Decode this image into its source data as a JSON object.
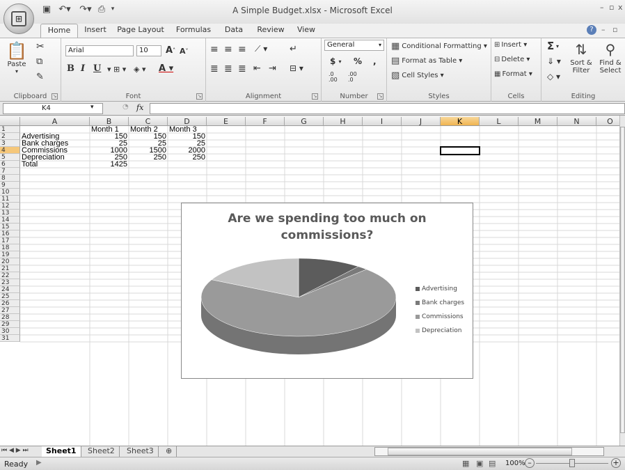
{
  "window": {
    "title": "A Simple Budget.xlsx - Microsoft Excel"
  },
  "quick_access": [
    "save-icon",
    "undo-icon",
    "redo-icon",
    "customize-icon"
  ],
  "tabs": [
    "Home",
    "Insert",
    "Page Layout",
    "Formulas",
    "Data",
    "Review",
    "View"
  ],
  "ribbon": {
    "clipboard": {
      "label": "Clipboard",
      "paste": "Paste"
    },
    "font": {
      "label": "Font",
      "font_name": "Arial",
      "font_size": "10",
      "bold": "B",
      "italic": "I",
      "underline": "U",
      "grow": "A",
      "shrink": "A"
    },
    "alignment": {
      "label": "Alignment"
    },
    "number": {
      "label": "Number",
      "format": "General",
      "currency": "$",
      "percent": "%",
      "comma": ",",
      "inc_dec": ".0 .00",
      "dec_dec": ".00 .0"
    },
    "styles": {
      "label": "Styles",
      "conditional": "Conditional Formatting",
      "format_table": "Format as Table",
      "cell_styles": "Cell Styles"
    },
    "cells": {
      "label": "Cells",
      "insert": "Insert",
      "delete": "Delete",
      "format": "Format"
    },
    "editing": {
      "label": "Editing",
      "sigma": "Σ",
      "sort_filter": "Sort & Filter",
      "find_select": "Find & Select"
    }
  },
  "formula_bar": {
    "name_box": "K4",
    "fx": "fx",
    "value": ""
  },
  "columns": [
    "A",
    "B",
    "C",
    "D",
    "E",
    "F",
    "G",
    "H",
    "I",
    "J",
    "K",
    "L",
    "M",
    "N",
    "O"
  ],
  "rows": [
    "1",
    "2",
    "3",
    "4",
    "5",
    "6",
    "7",
    "8",
    "9",
    "10",
    "11",
    "12",
    "13",
    "14",
    "15",
    "16",
    "17",
    "18",
    "19",
    "20",
    "21",
    "22",
    "23",
    "24",
    "25",
    "26",
    "27",
    "28",
    "29",
    "30",
    "31"
  ],
  "selected_cell": "K4",
  "sheet": {
    "headers": [
      "",
      "Month 1",
      "Month 2",
      "Month 3"
    ],
    "data": [
      {
        "label": "Advertising",
        "values": [
          "150",
          "150",
          "150"
        ]
      },
      {
        "label": "Bank charges",
        "values": [
          "25",
          "25",
          "25"
        ]
      },
      {
        "label": "Commissions",
        "values": [
          "1000",
          "1500",
          "2000"
        ]
      },
      {
        "label": "Depreciation",
        "values": [
          "250",
          "250",
          "250"
        ]
      },
      {
        "label": "Total",
        "values": [
          "1425",
          "",
          ""
        ]
      }
    ]
  },
  "chart_data": {
    "type": "pie",
    "title": "Are we spending too much on commissions?",
    "categories": [
      "Advertising",
      "Bank charges",
      "Commissions",
      "Depreciation"
    ],
    "values": [
      150,
      25,
      1000,
      250
    ],
    "colors": [
      "#5c5c5c",
      "#7a7a7a",
      "#9a9a9a",
      "#c2c2c2"
    ],
    "legend_position": "right"
  },
  "sheet_tabs": [
    "Sheet1",
    "Sheet2",
    "Sheet3"
  ],
  "active_sheet": "Sheet1",
  "status": {
    "ready": "Ready",
    "zoom": "100%"
  }
}
